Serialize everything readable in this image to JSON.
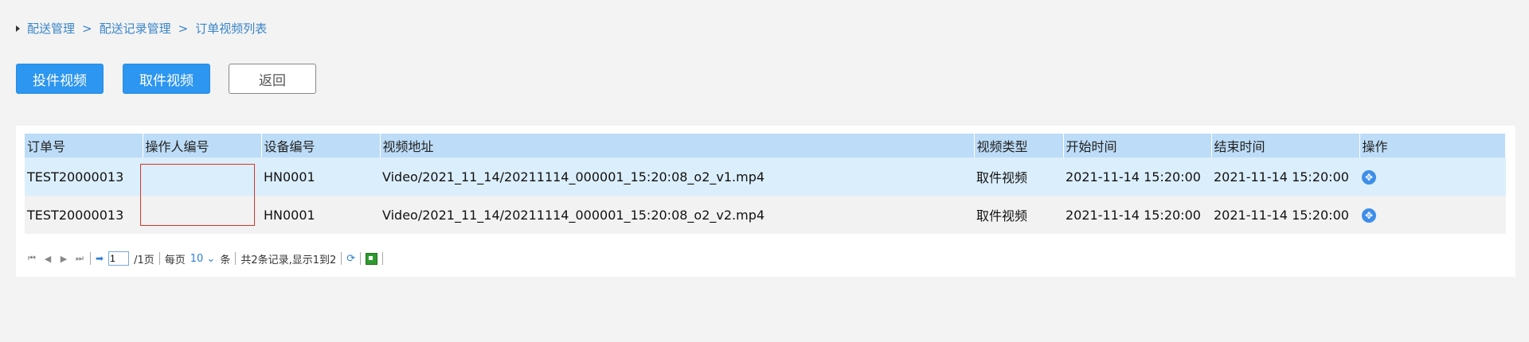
{
  "breadcrumb": {
    "items": [
      "配送管理",
      "配送记录管理",
      "订单视频列表"
    ],
    "separator": ">"
  },
  "toolbar": {
    "deliver_video_label": "投件视频",
    "pickup_video_label": "取件视频",
    "back_label": "返回"
  },
  "table": {
    "headers": [
      "订单号",
      "操作人编号",
      "设备编号",
      "视频地址",
      "视频类型",
      "开始时间",
      "结束时间",
      "操作"
    ],
    "rows": [
      {
        "order_no": "TEST20000013",
        "operator_no": "",
        "device_no": "HN0001",
        "video_url": "Video/2021_11_14/20211114_000001_15:20:08_o2_v1.mp4",
        "video_type": "取件视频",
        "start_time": "2021-11-14 15:20:00",
        "end_time": "2021-11-14 15:20:00",
        "action_icon": "move-icon"
      },
      {
        "order_no": "TEST20000013",
        "operator_no": "",
        "device_no": "HN0001",
        "video_url": "Video/2021_11_14/20211114_000001_15:20:08_o2_v2.mp4",
        "video_type": "取件视频",
        "start_time": "2021-11-14 15:20:00",
        "end_time": "2021-11-14 15:20:00",
        "action_icon": "move-icon"
      }
    ]
  },
  "pager": {
    "current_page": "1",
    "total_pages_text": "/1页",
    "per_page_label": "每页",
    "per_page_value": "10",
    "per_page_suffix": "条",
    "summary": "共2条记录,显示1到2"
  },
  "colors": {
    "primary_button": "#2c96f0",
    "header_bg": "#bcdcf7",
    "highlight_row": "#dbeefb",
    "annotation_box": "#d9342b"
  }
}
